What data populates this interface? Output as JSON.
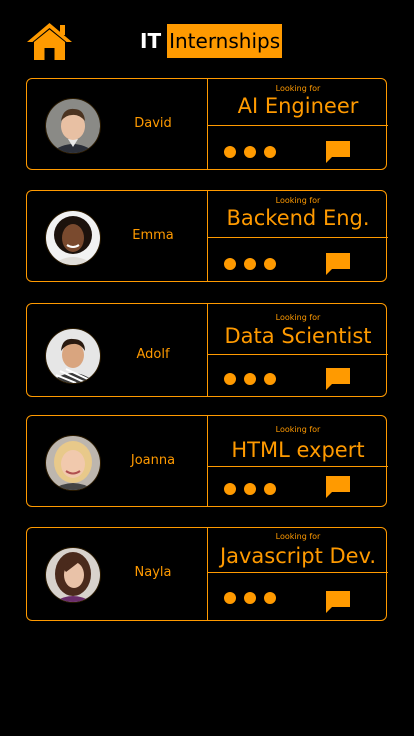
{
  "header": {
    "brand_prefix": "IT",
    "brand_word": "Internships",
    "accent_color": "#ff9a00"
  },
  "candidates": [
    {
      "name": "David",
      "looking_for_label": "Looking for",
      "role": "AI Engineer"
    },
    {
      "name": "Emma",
      "looking_for_label": "Looking for",
      "role": "Backend Eng."
    },
    {
      "name": "Adolf",
      "looking_for_label": "Looking for",
      "role": "Data Scientist"
    },
    {
      "name": "Joanna",
      "looking_for_label": "Looking for",
      "role": "HTML expert"
    },
    {
      "name": "Nayla",
      "looking_for_label": "Looking for",
      "role": "Javascript Dev."
    }
  ],
  "icons": {
    "home": "home-icon",
    "more": "more-dots-icon",
    "message": "chat-bubble-icon"
  }
}
